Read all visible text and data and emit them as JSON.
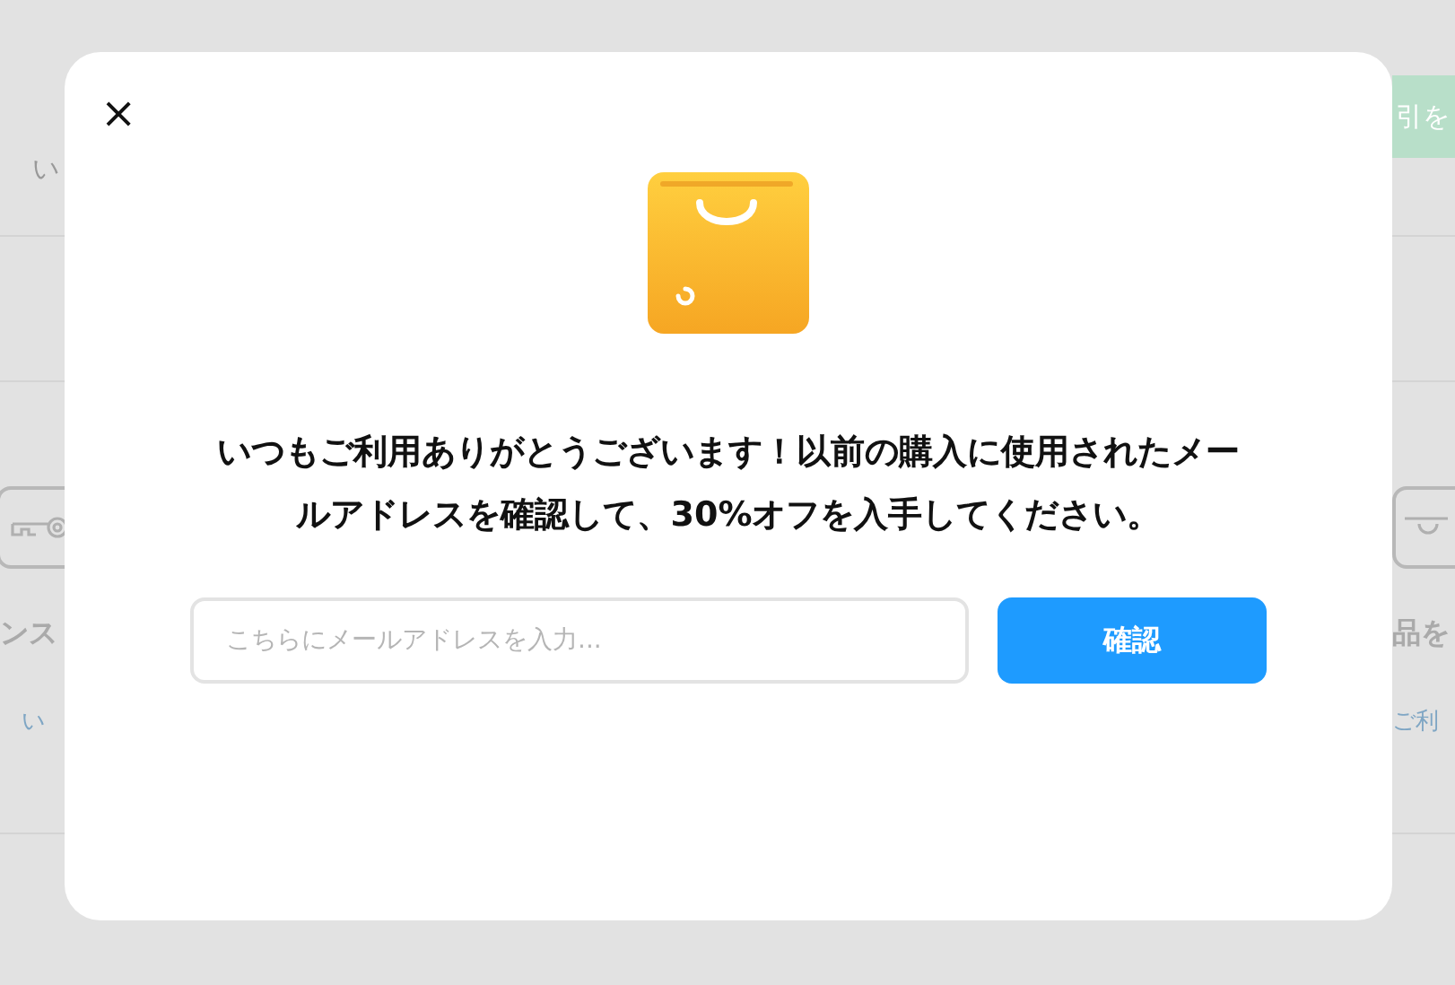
{
  "background": {
    "left": {
      "note": "い",
      "section_title": "ンス",
      "link": "い"
    },
    "right": {
      "button": "引を",
      "section_title": "品を",
      "link": "ご利"
    }
  },
  "modal": {
    "close": "×",
    "message": "いつもご利用ありがとうございます！以前の購入に使用されたメールアドレスを確認して、30%オフを入手してください。",
    "email": {
      "placeholder": "こちらにメールアドレスを入力..."
    },
    "submit": "確認"
  }
}
